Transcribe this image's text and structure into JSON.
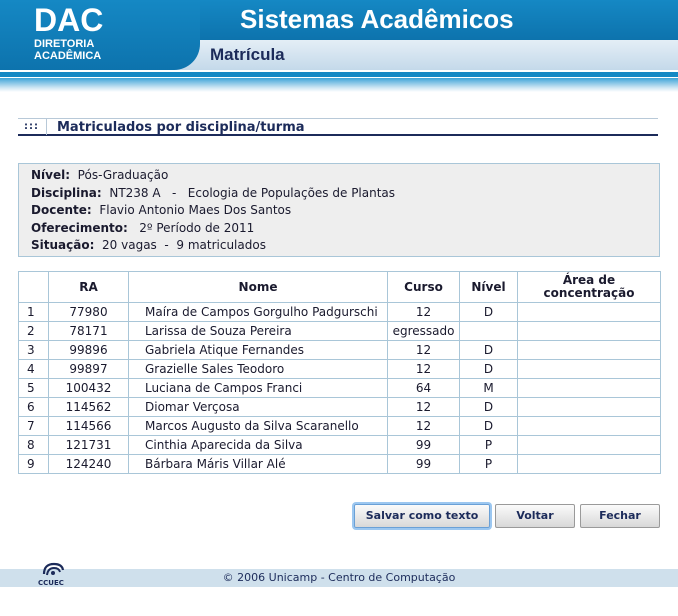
{
  "header": {
    "logo_main": "DAC",
    "logo_line1": "DIRETORIA",
    "logo_line2": "ACADÊMICA",
    "app_title": "Sistemas Acadêmicos",
    "section_title": "Matrícula"
  },
  "box": {
    "dots": ":::",
    "title": "Matriculados por disciplina/turma"
  },
  "info": {
    "nivel_label": "Nível:",
    "nivel_value": "Pós-Graduação",
    "disciplina_label": "Disciplina:",
    "disciplina_value": "NT238 A   -   Ecologia de Populações de Plantas",
    "docente_label": "Docente:",
    "docente_value": "Flavio Antonio Maes Dos Santos",
    "oferecimento_label": "Oferecimento:",
    "oferecimento_value": "2º Período de 2011",
    "situacao_label": "Situação:",
    "situacao_value": "20 vagas  -  9 matriculados"
  },
  "table": {
    "headers": {
      "idx": "",
      "ra": "RA",
      "nome": "Nome",
      "curso": "Curso",
      "nivel": "Nível",
      "area": "Área de concentração"
    },
    "rows": [
      {
        "idx": "1",
        "ra": "77980",
        "nome": "Maíra de Campos Gorgulho Padgurschi",
        "curso": "12",
        "nivel": "D",
        "area": ""
      },
      {
        "idx": "2",
        "ra": "78171",
        "nome": "Larissa de Souza Pereira",
        "curso": "egressado",
        "nivel": "",
        "area": ""
      },
      {
        "idx": "3",
        "ra": "99896",
        "nome": "Gabriela Atique Fernandes",
        "curso": "12",
        "nivel": "D",
        "area": ""
      },
      {
        "idx": "4",
        "ra": "99897",
        "nome": "Grazielle Sales Teodoro",
        "curso": "12",
        "nivel": "D",
        "area": ""
      },
      {
        "idx": "5",
        "ra": "100432",
        "nome": "Luciana de Campos Franci",
        "curso": "64",
        "nivel": "M",
        "area": ""
      },
      {
        "idx": "6",
        "ra": "114562",
        "nome": "Diomar Verçosa",
        "curso": "12",
        "nivel": "D",
        "area": ""
      },
      {
        "idx": "7",
        "ra": "114566",
        "nome": "Marcos Augusto da Silva Scaranello",
        "curso": "12",
        "nivel": "D",
        "area": ""
      },
      {
        "idx": "8",
        "ra": "121731",
        "nome": "Cinthia Aparecida da Silva",
        "curso": "99",
        "nivel": "P",
        "area": ""
      },
      {
        "idx": "9",
        "ra": "124240",
        "nome": "Bárbara Máris Villar Alé",
        "curso": "99",
        "nivel": "P",
        "area": ""
      }
    ]
  },
  "buttons": {
    "save": "Salvar como texto",
    "back": "Voltar",
    "close": "Fechar"
  },
  "footer": {
    "logo_label": "CCUEC",
    "text": "© 2006 Unicamp - Centro de Computação"
  },
  "colors": {
    "brand_blue": "#1588c4",
    "navy": "#1c2b5a",
    "band_light": "#cfe0ec"
  }
}
